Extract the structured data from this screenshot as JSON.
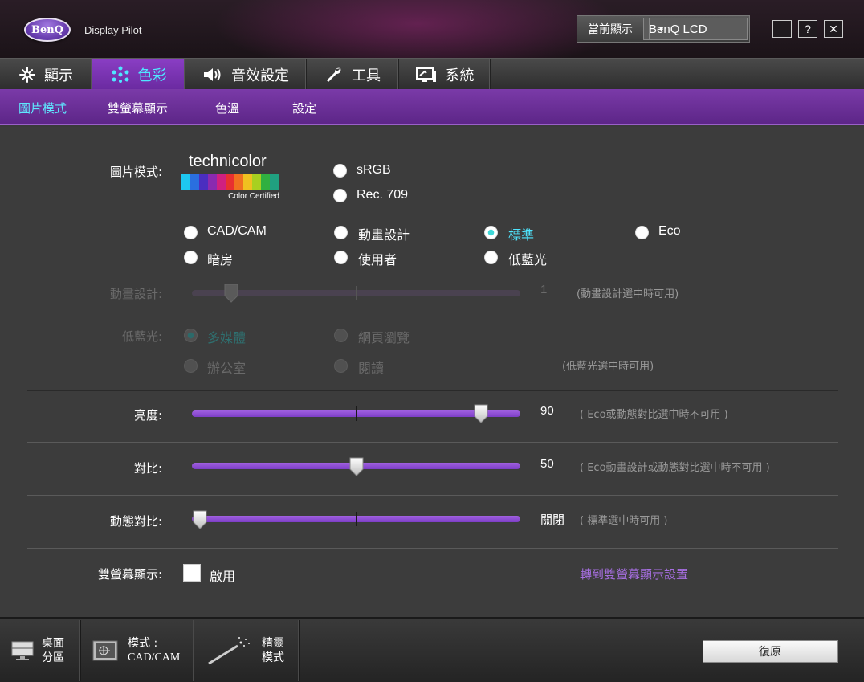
{
  "app": {
    "logo_text": "BenQ",
    "title": "Display Pilot"
  },
  "header": {
    "current_display_label": "當前顯示",
    "current_display_value": "BenQ LCD",
    "minimize": "_",
    "help": "?",
    "close": "✕"
  },
  "main_tabs": [
    {
      "label": "顯示",
      "icon": "display-sparkle-icon"
    },
    {
      "label": "色彩",
      "icon": "color-dots-icon",
      "active": true
    },
    {
      "label": "音效設定",
      "icon": "speaker-icon"
    },
    {
      "label": "工具",
      "icon": "wrench-icon"
    },
    {
      "label": "系統",
      "icon": "system-monitor-icon"
    }
  ],
  "sub_tabs": [
    {
      "label": "圖片模式",
      "active": true
    },
    {
      "label": "雙螢幕顯示"
    },
    {
      "label": "色溫"
    },
    {
      "label": "設定"
    }
  ],
  "picture_mode": {
    "label": "圖片模式:",
    "technicolor_word": "technicolor",
    "technicolor_cert": "Color Certified",
    "options": {
      "srgb": "sRGB",
      "rec709": "Rec. 709",
      "cadcam": "CAD/CAM",
      "animation": "動畫設計",
      "standard": "標準",
      "eco": "Eco",
      "darkroom": "暗房",
      "user": "使用者",
      "low_blue": "低藍光"
    },
    "selected": "標準"
  },
  "animation_design": {
    "label": "動畫設計:",
    "value": "1",
    "note": "(動畫設計選中時可用)",
    "level": 0.1
  },
  "low_blue_light": {
    "label": "低藍光:",
    "options": {
      "multimedia": "多媒體",
      "web": "網頁瀏覽",
      "office": "辦公室",
      "reading": "閱讀"
    },
    "selected": "多媒體",
    "note": "(低藍光選中時可用)"
  },
  "brightness": {
    "label": "亮度:",
    "value": "90",
    "level": 0.9,
    "note": "( Eco或動態對比選中時不可用 )"
  },
  "contrast": {
    "label": "對比:",
    "value": "50",
    "level": 0.5,
    "note": "( Eco動畫設計或動態對比選中時不可用 )"
  },
  "dynamic_contrast": {
    "label": "動態對比:",
    "value": "關閉",
    "level": 0.0,
    "note": "( 標準選中時可用 )"
  },
  "dual_display": {
    "label": "雙螢幕顯示:",
    "checkbox_label": "啟用",
    "link": "轉到雙螢幕顯示設置"
  },
  "bottom": {
    "desktop_partition": [
      "桌面",
      "分區"
    ],
    "mode": [
      "模式 :",
      "CAD/CAM"
    ],
    "genie": [
      "精靈",
      "模式"
    ],
    "restore": "復原"
  },
  "colors": {
    "accent_purple": "#7d3ec6",
    "active_cyan": "#4fe6ff",
    "link_purple": "#a66ee0"
  }
}
